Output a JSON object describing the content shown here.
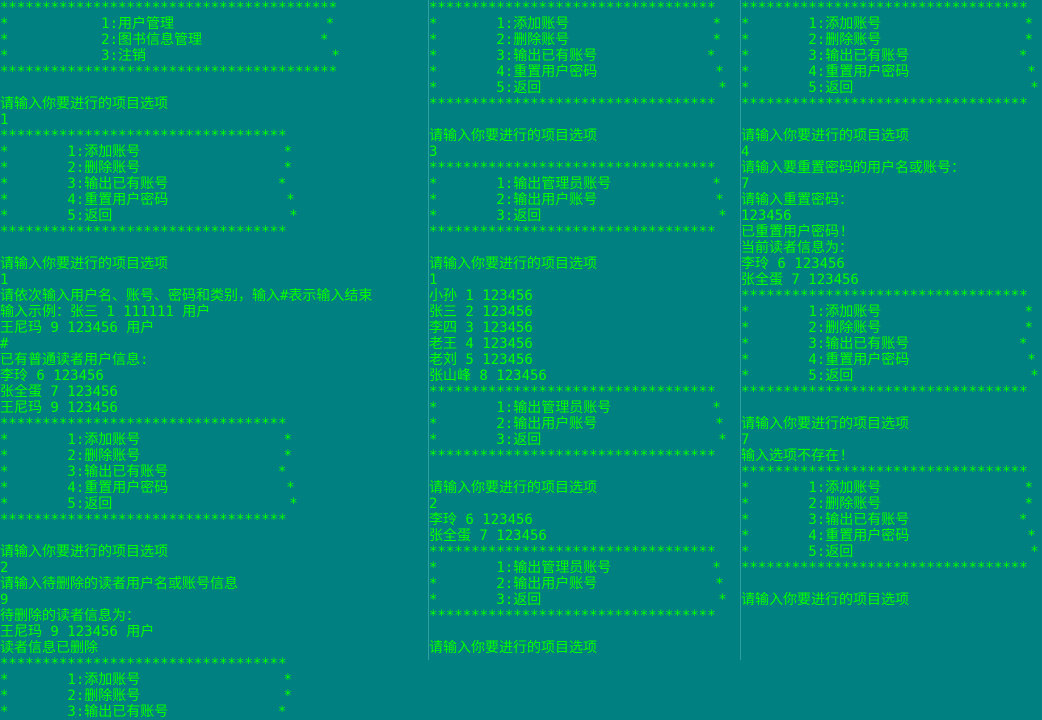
{
  "panes": [
    {
      "lines": [
        "****************************************",
        "*           1:用户管理                  *",
        "*           2:图书信息管理              *",
        "*           3:注销                      *",
        "****************************************",
        "",
        "请输入你要进行的项目选项",
        "1",
        "**********************************",
        "*       1:添加账号                 *",
        "*       2:删除账号                 *",
        "*       3:输出已有账号             *",
        "*       4:重置用户密码              *",
        "*       5:返回                     *",
        "**********************************",
        "",
        "请输入你要进行的项目选项",
        "1",
        "请依次输入用户名、账号、密码和类别，输入#表示输入结束",
        "输入示例：张三 1 111111 用户",
        "王尼玛 9 123456 用户",
        "#",
        "已有普通读者用户信息:",
        "李玲 6 123456",
        "张全蛋 7 123456",
        "王尼玛 9 123456",
        "**********************************",
        "*       1:添加账号                 *",
        "*       2:删除账号                 *",
        "*       3:输出已有账号             *",
        "*       4:重置用户密码              *",
        "*       5:返回                     *",
        "**********************************",
        "",
        "请输入你要进行的项目选项",
        "2",
        "请输入待删除的读者用户名或账号信息",
        "9",
        "待删除的读者信息为：",
        "王尼玛 9 123456 用户",
        "读者信息已删除",
        "**********************************",
        "*       1:添加账号                 *",
        "*       2:删除账号                 *",
        "*       3:输出已有账号             *"
      ]
    },
    {
      "lines": [
        "**********************************",
        "*       1:添加账号                 *",
        "*       2:删除账号                 *",
        "*       3:输出已有账号             *",
        "*       4:重置用户密码              *",
        "*       5:返回                     *",
        "**********************************",
        "",
        "请输入你要进行的项目选项",
        "3",
        "**********************************",
        "*       1:输出管理员账号            *",
        "*       2:输出用户账号              *",
        "*       3:返回                     *",
        "**********************************",
        "",
        "请输入你要进行的项目选项",
        "1",
        "小孙 1 123456",
        "张三 2 123456",
        "李四 3 123456",
        "老王 4 123456",
        "老刘 5 123456",
        "张山峰 8 123456",
        "**********************************",
        "*       1:输出管理员账号            *",
        "*       2:输出用户账号              *",
        "*       3:返回                     *",
        "**********************************",
        "",
        "请输入你要进行的项目选项",
        "2",
        "李玲 6 123456",
        "张全蛋 7 123456",
        "**********************************",
        "*       1:输出管理员账号            *",
        "*       2:输出用户账号              *",
        "*       3:返回                     *",
        "**********************************",
        "",
        "请输入你要进行的项目选项"
      ]
    },
    {
      "lines": [
        "**********************************",
        "*       1:添加账号                 *",
        "*       2:删除账号                 *",
        "*       3:输出已有账号             *",
        "*       4:重置用户密码              *",
        "*       5:返回                     *",
        "**********************************",
        "",
        "请输入你要进行的项目选项",
        "4",
        "请输入要重置密码的用户名或账号：",
        "7",
        "请输入重置密码：",
        "123456",
        "已重置用户密码!",
        "当前读者信息为：",
        "李玲 6 123456",
        "张全蛋 7 123456",
        "**********************************",
        "*       1:添加账号                 *",
        "*       2:删除账号                 *",
        "*       3:输出已有账号             *",
        "*       4:重置用户密码              *",
        "*       5:返回                     *",
        "**********************************",
        "",
        "请输入你要进行的项目选项",
        "7",
        "输入选项不存在!",
        "**********************************",
        "*       1:添加账号                 *",
        "*       2:删除账号                 *",
        "*       3:输出已有账号             *",
        "*       4:重置用户密码              *",
        "*       5:返回                     *",
        "**********************************",
        "",
        "请输入你要进行的项目选项"
      ]
    }
  ],
  "colors": {
    "background": "#008080",
    "text": "#00ff00"
  }
}
